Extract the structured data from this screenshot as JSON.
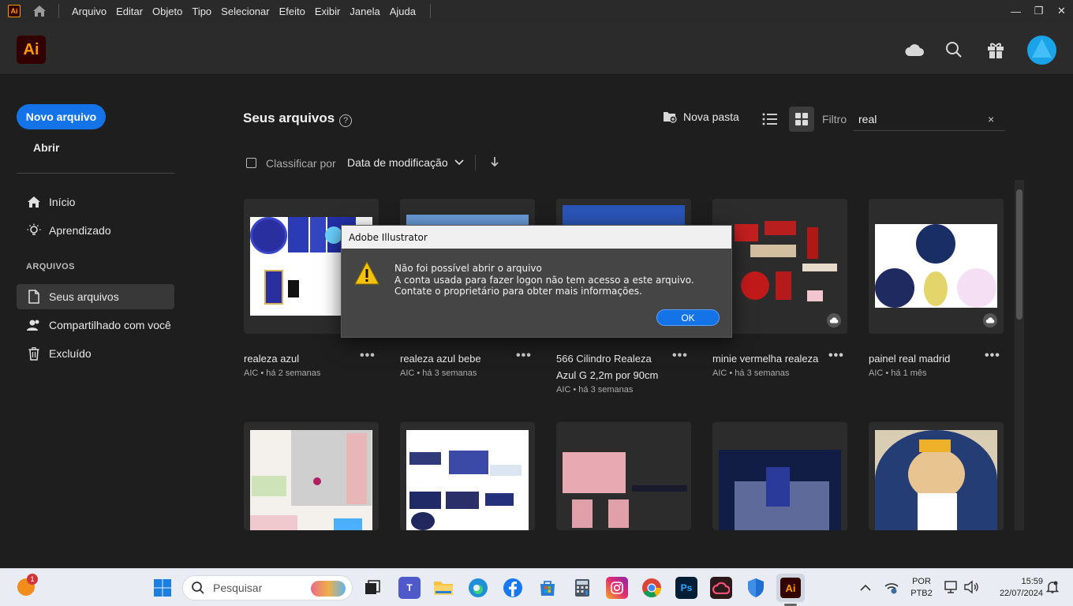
{
  "menubar": {
    "items": [
      "Arquivo",
      "Editar",
      "Objeto",
      "Tipo",
      "Selecionar",
      "Efeito",
      "Exibir",
      "Janela",
      "Ajuda"
    ],
    "app_mini": "Ai"
  },
  "header": {
    "logo": "Ai"
  },
  "sidebar": {
    "new_file": "Novo arquivo",
    "open": "Abrir",
    "home": "Início",
    "learn": "Aprendizado",
    "section": "ARQUIVOS",
    "your_files": "Seus arquivos",
    "shared": "Compartilhado com você",
    "deleted": "Excluído"
  },
  "main": {
    "title": "Seus arquivos",
    "help": "?",
    "new_folder": "Nova pasta",
    "filter_label": "Filtro",
    "filter_value": "real",
    "filter_clear": "×",
    "sort_label": "Classificar por",
    "sort_value": "Data de modificação"
  },
  "files": [
    {
      "title": "realeza azul",
      "meta": "AIC • há 2 semanas",
      "more": "•••"
    },
    {
      "title": "realeza azul bebe",
      "meta": "AIC • há 3 semanas",
      "more": "•••"
    },
    {
      "title": "566 Cilindro Realeza Azul G 2,2m por 90cm",
      "meta": "AIC • há 3 semanas",
      "more": "•••"
    },
    {
      "title": "minie vermelha realeza",
      "meta": "AIC • há 3 semanas",
      "more": "•••"
    },
    {
      "title": "painel real madrid",
      "meta": "AIC • há 1 mês",
      "more": "•••"
    }
  ],
  "dialog": {
    "title": "Adobe Illustrator",
    "line1": "Não foi possível abrir o arquivo",
    "line2": "A conta usada para fazer logon não tem acesso a este arquivo. Contate o proprietário para obter mais informações.",
    "ok": "OK"
  },
  "taskbar": {
    "search_placeholder": "Pesquisar",
    "notification_count": "1",
    "lang1": "POR",
    "lang2": "PTB2",
    "time": "15:59",
    "date": "22/07/2024",
    "ps": "Ps",
    "ai": "Ai"
  }
}
